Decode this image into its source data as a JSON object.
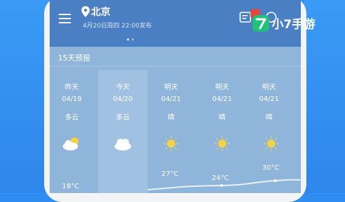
{
  "header": {
    "city": "北京",
    "update_text": "4月20日周四 22:00发布"
  },
  "panel": {
    "title": "15天预报"
  },
  "forecast": [
    {
      "weekday": "昨天",
      "date": "04/19",
      "condition": "多云",
      "icon": "partly-cloudy-icon",
      "temp": "18°C"
    },
    {
      "weekday": "今天",
      "date": "04/20",
      "condition": "多云",
      "icon": "cloud-icon",
      "temp": ""
    },
    {
      "weekday": "明天",
      "date": "04/21",
      "condition": "晴",
      "icon": "sun-icon",
      "temp": "27°C"
    },
    {
      "weekday": "明天",
      "date": "04/21",
      "condition": "晴",
      "icon": "sun-icon",
      "temp": "24°C"
    },
    {
      "weekday": "明天",
      "date": "04/21",
      "condition": "晴",
      "icon": "sun-icon",
      "temp": "30°C"
    }
  ],
  "watermark": {
    "logo_icon": "7-logo-icon",
    "text": "小7手游"
  },
  "colors": {
    "background": "#2f8cf0",
    "topbar": "#4a7fc3",
    "panel": "#8fb5da",
    "accent_green": "#22c178",
    "sun": "#f2d24a"
  }
}
